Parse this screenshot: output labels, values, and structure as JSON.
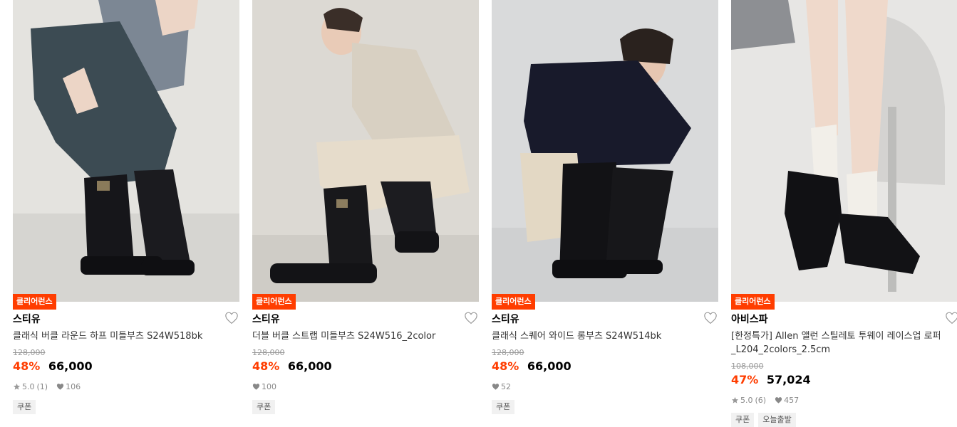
{
  "colors": {
    "accent": "#ff3d00",
    "badge_text": "#ffffff",
    "muted": "#999999"
  },
  "products": [
    {
      "badge": "클리어런스",
      "brand": "스티유",
      "name": "클래식 버클 라운드 하프 미들부츠 S24W518bk",
      "original_price": "128,000",
      "discount": "48%",
      "price": "66,000",
      "rating": "5.0",
      "reviews": "(1)",
      "likes": "106",
      "tags": [
        "쿠폰"
      ]
    },
    {
      "badge": "클리어런스",
      "brand": "스티유",
      "name": "더블 버클 스트랩 미들부츠 S24W516_2color",
      "original_price": "128,000",
      "discount": "48%",
      "price": "66,000",
      "likes": "100",
      "tags": [
        "쿠폰"
      ]
    },
    {
      "badge": "클리어런스",
      "brand": "스티유",
      "name": "클래식 스퀘어 와이드 롱부츠 S24W514bk",
      "original_price": "128,000",
      "discount": "48%",
      "price": "66,000",
      "likes": "52",
      "tags": [
        "쿠폰"
      ]
    },
    {
      "badge": "클리어런스",
      "brand": "아비스파",
      "name": "[한정특가] Allen 앨런 스틸레토 투웨이 레이스업 로퍼 _L204_2colors_2.5cm",
      "original_price": "108,000",
      "discount": "47%",
      "price": "57,024",
      "rating": "5.0",
      "reviews": "(6)",
      "likes": "457",
      "tags": [
        "쿠폰",
        "오늘출발"
      ]
    }
  ]
}
